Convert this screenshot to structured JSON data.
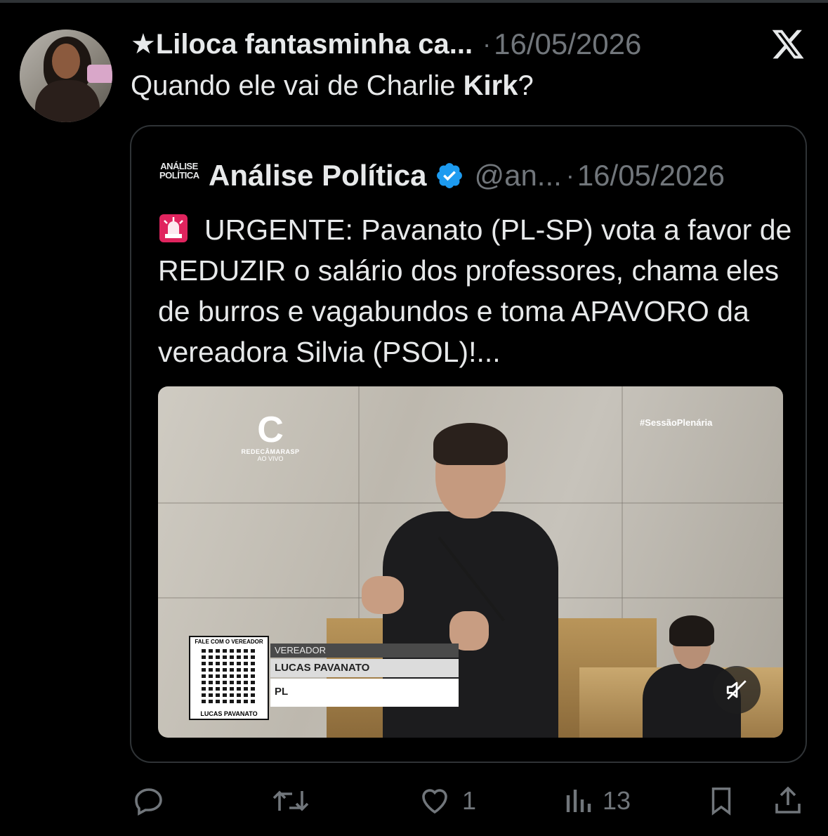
{
  "colors": {
    "background": "#000000",
    "text": "#e7e9ea",
    "muted": "#71767b",
    "border": "#2f3336",
    "verified": "#1d9bf0"
  },
  "tweet": {
    "author_name": "★Liloca fantasminha ca...",
    "separator": "·",
    "date": "16/05/2026",
    "text_before": "Quando ele vai de Charlie ",
    "text_bold": "Kirk",
    "text_after": "?"
  },
  "quote": {
    "avatar_text_line1": "ANÁLISE",
    "avatar_text_line2": "POLÍTICA",
    "author_name": "Análise Política",
    "handle": "@an...",
    "separator": "·",
    "date": "16/05/2026",
    "text": "URGENTE: Pavanato (PL-SP) vota a favor de REDUZIR o salário dos professores, chama eles de burros e vagabundos e toma APAVORO da vereadora Silvia (PSOL)!...",
    "media": {
      "logo_letter": "C",
      "logo_line1": "REDECÂMARASP",
      "logo_line2": "AO VIVO",
      "hashtag": "#SessãoPlenária",
      "qr_title": "FALE COM O VEREADOR",
      "qr_name": "LUCAS PAVANATO",
      "lower_label": "VEREADOR",
      "lower_name": "LUCAS PAVANATO",
      "lower_party": "PL"
    }
  },
  "actions": {
    "reply_count": "",
    "retweet_count": "",
    "like_count": "1",
    "views_count": "13"
  },
  "icons": [
    "x-logo-icon",
    "verified-badge-icon",
    "siren-icon",
    "mute-icon",
    "reply-icon",
    "retweet-icon",
    "like-icon",
    "views-icon",
    "bookmark-icon",
    "share-icon"
  ]
}
